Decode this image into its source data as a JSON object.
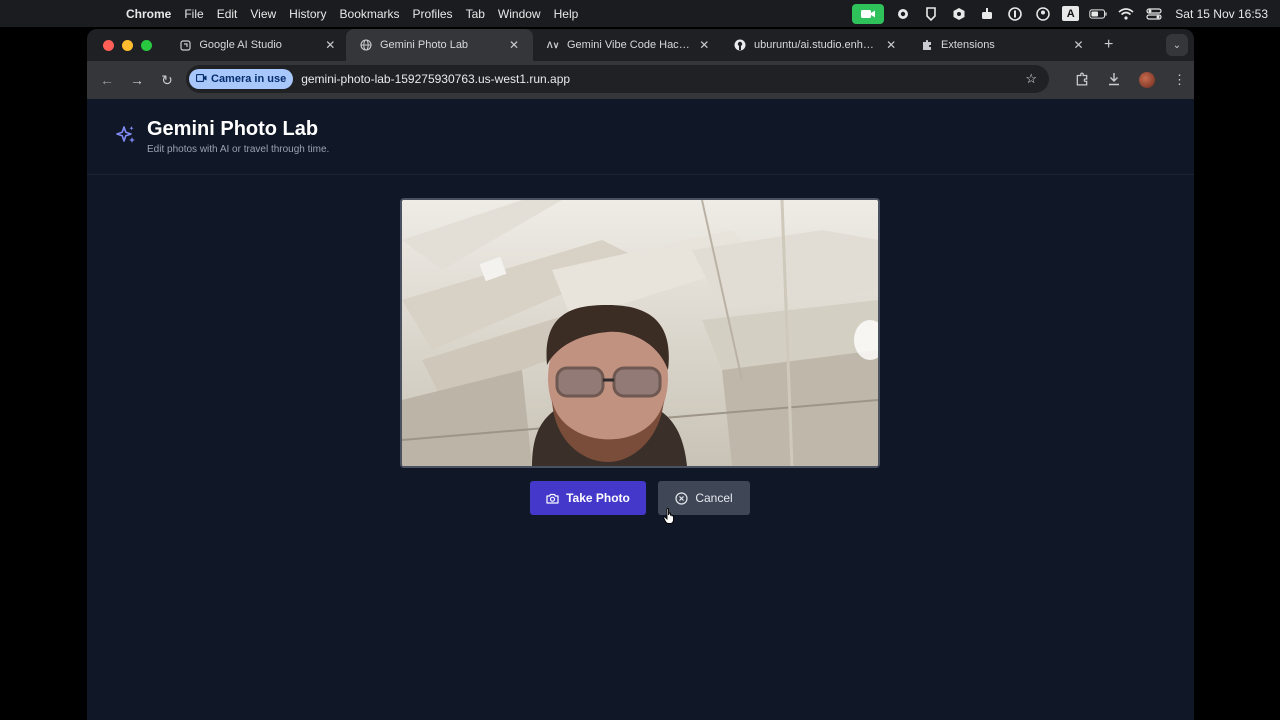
{
  "menubar": {
    "app": "Chrome",
    "items": [
      "File",
      "Edit",
      "View",
      "History",
      "Bookmarks",
      "Profiles",
      "Tab",
      "Window",
      "Help"
    ],
    "status_icons": [
      "camera-active-icon",
      "record-icon",
      "shield-icon",
      "hexagon-icon",
      "bot-icon",
      "1password-icon",
      "user-circle-icon",
      "input-a-icon",
      "battery-icon",
      "wifi-icon",
      "control-center-icon"
    ],
    "input_label": "A",
    "clock": "Sat 15 Nov  16:53"
  },
  "browser": {
    "tabs": [
      {
        "title": "Google AI Studio",
        "icon": "ai-studio-icon",
        "active": false
      },
      {
        "title": "Gemini Photo Lab",
        "icon": "globe-icon",
        "active": true
      },
      {
        "title": "Gemini Vibe Code Hackathon",
        "icon": "av-icon",
        "active": false
      },
      {
        "title": "uburuntu/ai.studio.enhancer",
        "icon": "github-icon",
        "active": false
      },
      {
        "title": "Extensions",
        "icon": "puzzle-icon",
        "active": false
      }
    ],
    "camera_chip": "Camera in use",
    "url": "gemini-photo-lab-159275930763.us-west1.run.app"
  },
  "app": {
    "title": "Gemini Photo Lab",
    "subtitle": "Edit photos with AI or travel through time.",
    "take_photo_label": "Take Photo",
    "cancel_label": "Cancel",
    "accent": "#4338ca"
  }
}
